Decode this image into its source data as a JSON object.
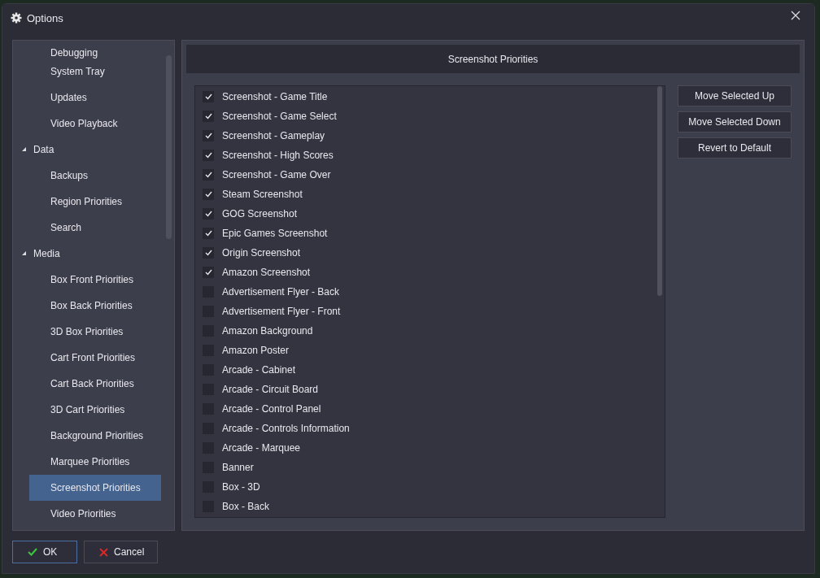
{
  "window": {
    "title": "Options"
  },
  "sidebar": {
    "items": [
      {
        "children": [
          {
            "label": "Debugging",
            "selected": false
          },
          {
            "label": "System Tray",
            "selected": false
          },
          {
            "label": "Updates",
            "selected": false
          },
          {
            "label": "Video Playback",
            "selected": false
          }
        ]
      },
      {
        "label": "Data",
        "expanded": true,
        "children": [
          {
            "label": "Backups",
            "selected": false
          },
          {
            "label": "Region Priorities",
            "selected": false
          },
          {
            "label": "Search",
            "selected": false
          }
        ]
      },
      {
        "label": "Media",
        "expanded": true,
        "children": [
          {
            "label": "Box Front Priorities",
            "selected": false
          },
          {
            "label": "Box Back Priorities",
            "selected": false
          },
          {
            "label": "3D Box Priorities",
            "selected": false
          },
          {
            "label": "Cart Front Priorities",
            "selected": false
          },
          {
            "label": "Cart Back Priorities",
            "selected": false
          },
          {
            "label": "3D Cart Priorities",
            "selected": false
          },
          {
            "label": "Background Priorities",
            "selected": false
          },
          {
            "label": "Marquee Priorities",
            "selected": false
          },
          {
            "label": "Screenshot Priorities",
            "selected": true
          },
          {
            "label": "Video Priorities",
            "selected": false
          }
        ]
      }
    ]
  },
  "panel": {
    "title": "Screenshot Priorities",
    "items": [
      {
        "label": "Screenshot - Game Title",
        "checked": true
      },
      {
        "label": "Screenshot - Game Select",
        "checked": true
      },
      {
        "label": "Screenshot - Gameplay",
        "checked": true
      },
      {
        "label": "Screenshot - High Scores",
        "checked": true
      },
      {
        "label": "Screenshot - Game Over",
        "checked": true
      },
      {
        "label": "Steam Screenshot",
        "checked": true
      },
      {
        "label": "GOG Screenshot",
        "checked": true
      },
      {
        "label": "Epic Games Screenshot",
        "checked": true
      },
      {
        "label": "Origin Screenshot",
        "checked": true
      },
      {
        "label": "Amazon Screenshot",
        "checked": true
      },
      {
        "label": "Advertisement Flyer - Back",
        "checked": false
      },
      {
        "label": "Advertisement Flyer - Front",
        "checked": false
      },
      {
        "label": "Amazon Background",
        "checked": false
      },
      {
        "label": "Amazon Poster",
        "checked": false
      },
      {
        "label": "Arcade - Cabinet",
        "checked": false
      },
      {
        "label": "Arcade - Circuit Board",
        "checked": false
      },
      {
        "label": "Arcade - Control Panel",
        "checked": false
      },
      {
        "label": "Arcade - Controls Information",
        "checked": false
      },
      {
        "label": "Arcade - Marquee",
        "checked": false
      },
      {
        "label": "Banner",
        "checked": false
      },
      {
        "label": "Box - 3D",
        "checked": false
      },
      {
        "label": "Box - Back",
        "checked": false
      }
    ],
    "buttons": [
      "Move Selected Up",
      "Move Selected Down",
      "Revert to Default"
    ]
  },
  "footer": {
    "buttons": [
      {
        "label": "OK",
        "kind": "ok"
      },
      {
        "label": "Cancel",
        "kind": "cancel"
      }
    ]
  }
}
